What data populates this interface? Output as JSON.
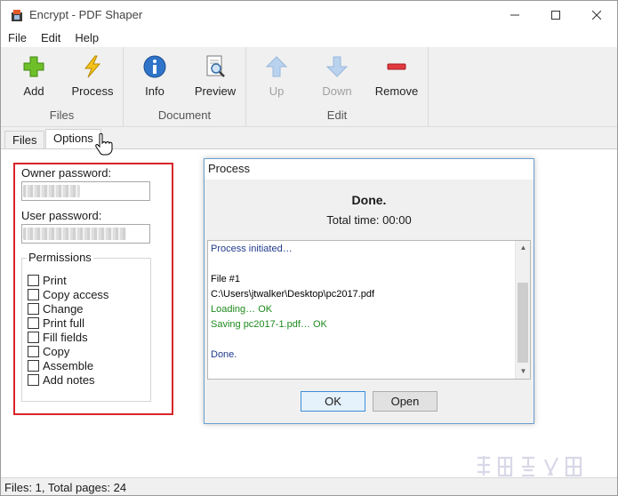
{
  "window": {
    "title": "Encrypt - PDF Shaper"
  },
  "menu": [
    "File",
    "Edit",
    "Help"
  ],
  "toolbar": {
    "files": {
      "label": "Files",
      "add": "Add",
      "process": "Process"
    },
    "document": {
      "label": "Document",
      "info": "Info",
      "preview": "Preview"
    },
    "edit": {
      "label": "Edit",
      "up": "Up",
      "down": "Down",
      "remove": "Remove"
    }
  },
  "tabs": {
    "files": "Files",
    "options": "Options"
  },
  "options": {
    "owner_password_label": "Owner password:",
    "user_password_label": "User password:",
    "permissions_label": "Permissions",
    "permissions": [
      "Print",
      "Copy access",
      "Change",
      "Print full",
      "Fill fields",
      "Copy",
      "Assemble",
      "Add notes"
    ]
  },
  "dialog": {
    "title": "Process",
    "status": "Done.",
    "total_time": "Total time: 00:00",
    "log": [
      {
        "text": "Process initiated…",
        "color": "#1f3a8a"
      },
      {
        "text": "",
        "color": "#000000"
      },
      {
        "text": "File #1",
        "color": "#000000"
      },
      {
        "text": "C:\\Users\\jtwalker\\Desktop\\pc2017.pdf",
        "color": "#000000"
      },
      {
        "text": "Loading… OK",
        "color": "#1e8a1e"
      },
      {
        "text": "Saving pc2017-1.pdf… OK",
        "color": "#1e8a1e"
      },
      {
        "text": "",
        "color": "#000000"
      },
      {
        "text": "Done.",
        "color": "#1f3a8a"
      }
    ],
    "ok": "OK",
    "open": "Open"
  },
  "status": {
    "text": "Files: 1, Total pages: 24"
  },
  "colors": {
    "highlight_border": "#d9232a",
    "accent": "#3c8ed8"
  }
}
